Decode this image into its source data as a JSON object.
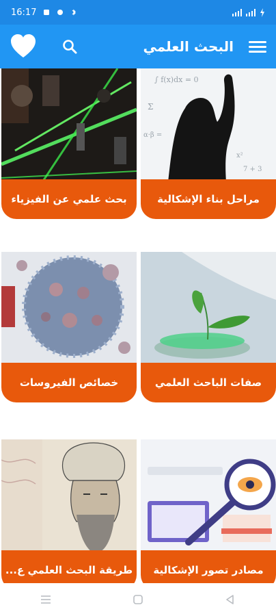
{
  "status_bar": {
    "time": "16:17"
  },
  "app_bar": {
    "title": "البحث العلمي"
  },
  "cards": [
    {
      "label": "مراحل بناء الإشكالية",
      "image": "silhouette-writing-on-board"
    },
    {
      "label": "بحث علمي عن الفيزياء",
      "image": "green-laser-lab"
    },
    {
      "label": "صفات الباحث العلمي",
      "image": "sprout-in-petri-dish"
    },
    {
      "label": "خصائص الفيروسات",
      "image": "virus-particles"
    },
    {
      "label": "مصادر تصور الإشكالية",
      "image": "magnifier-over-laptop"
    },
    {
      "label": "طريقة البحث العلمي ع...",
      "image": "scholar-portrait"
    }
  ],
  "colors": {
    "app_bar": "#2196f3",
    "status_bar": "#1e88e5",
    "card_label": "#e8590c"
  }
}
